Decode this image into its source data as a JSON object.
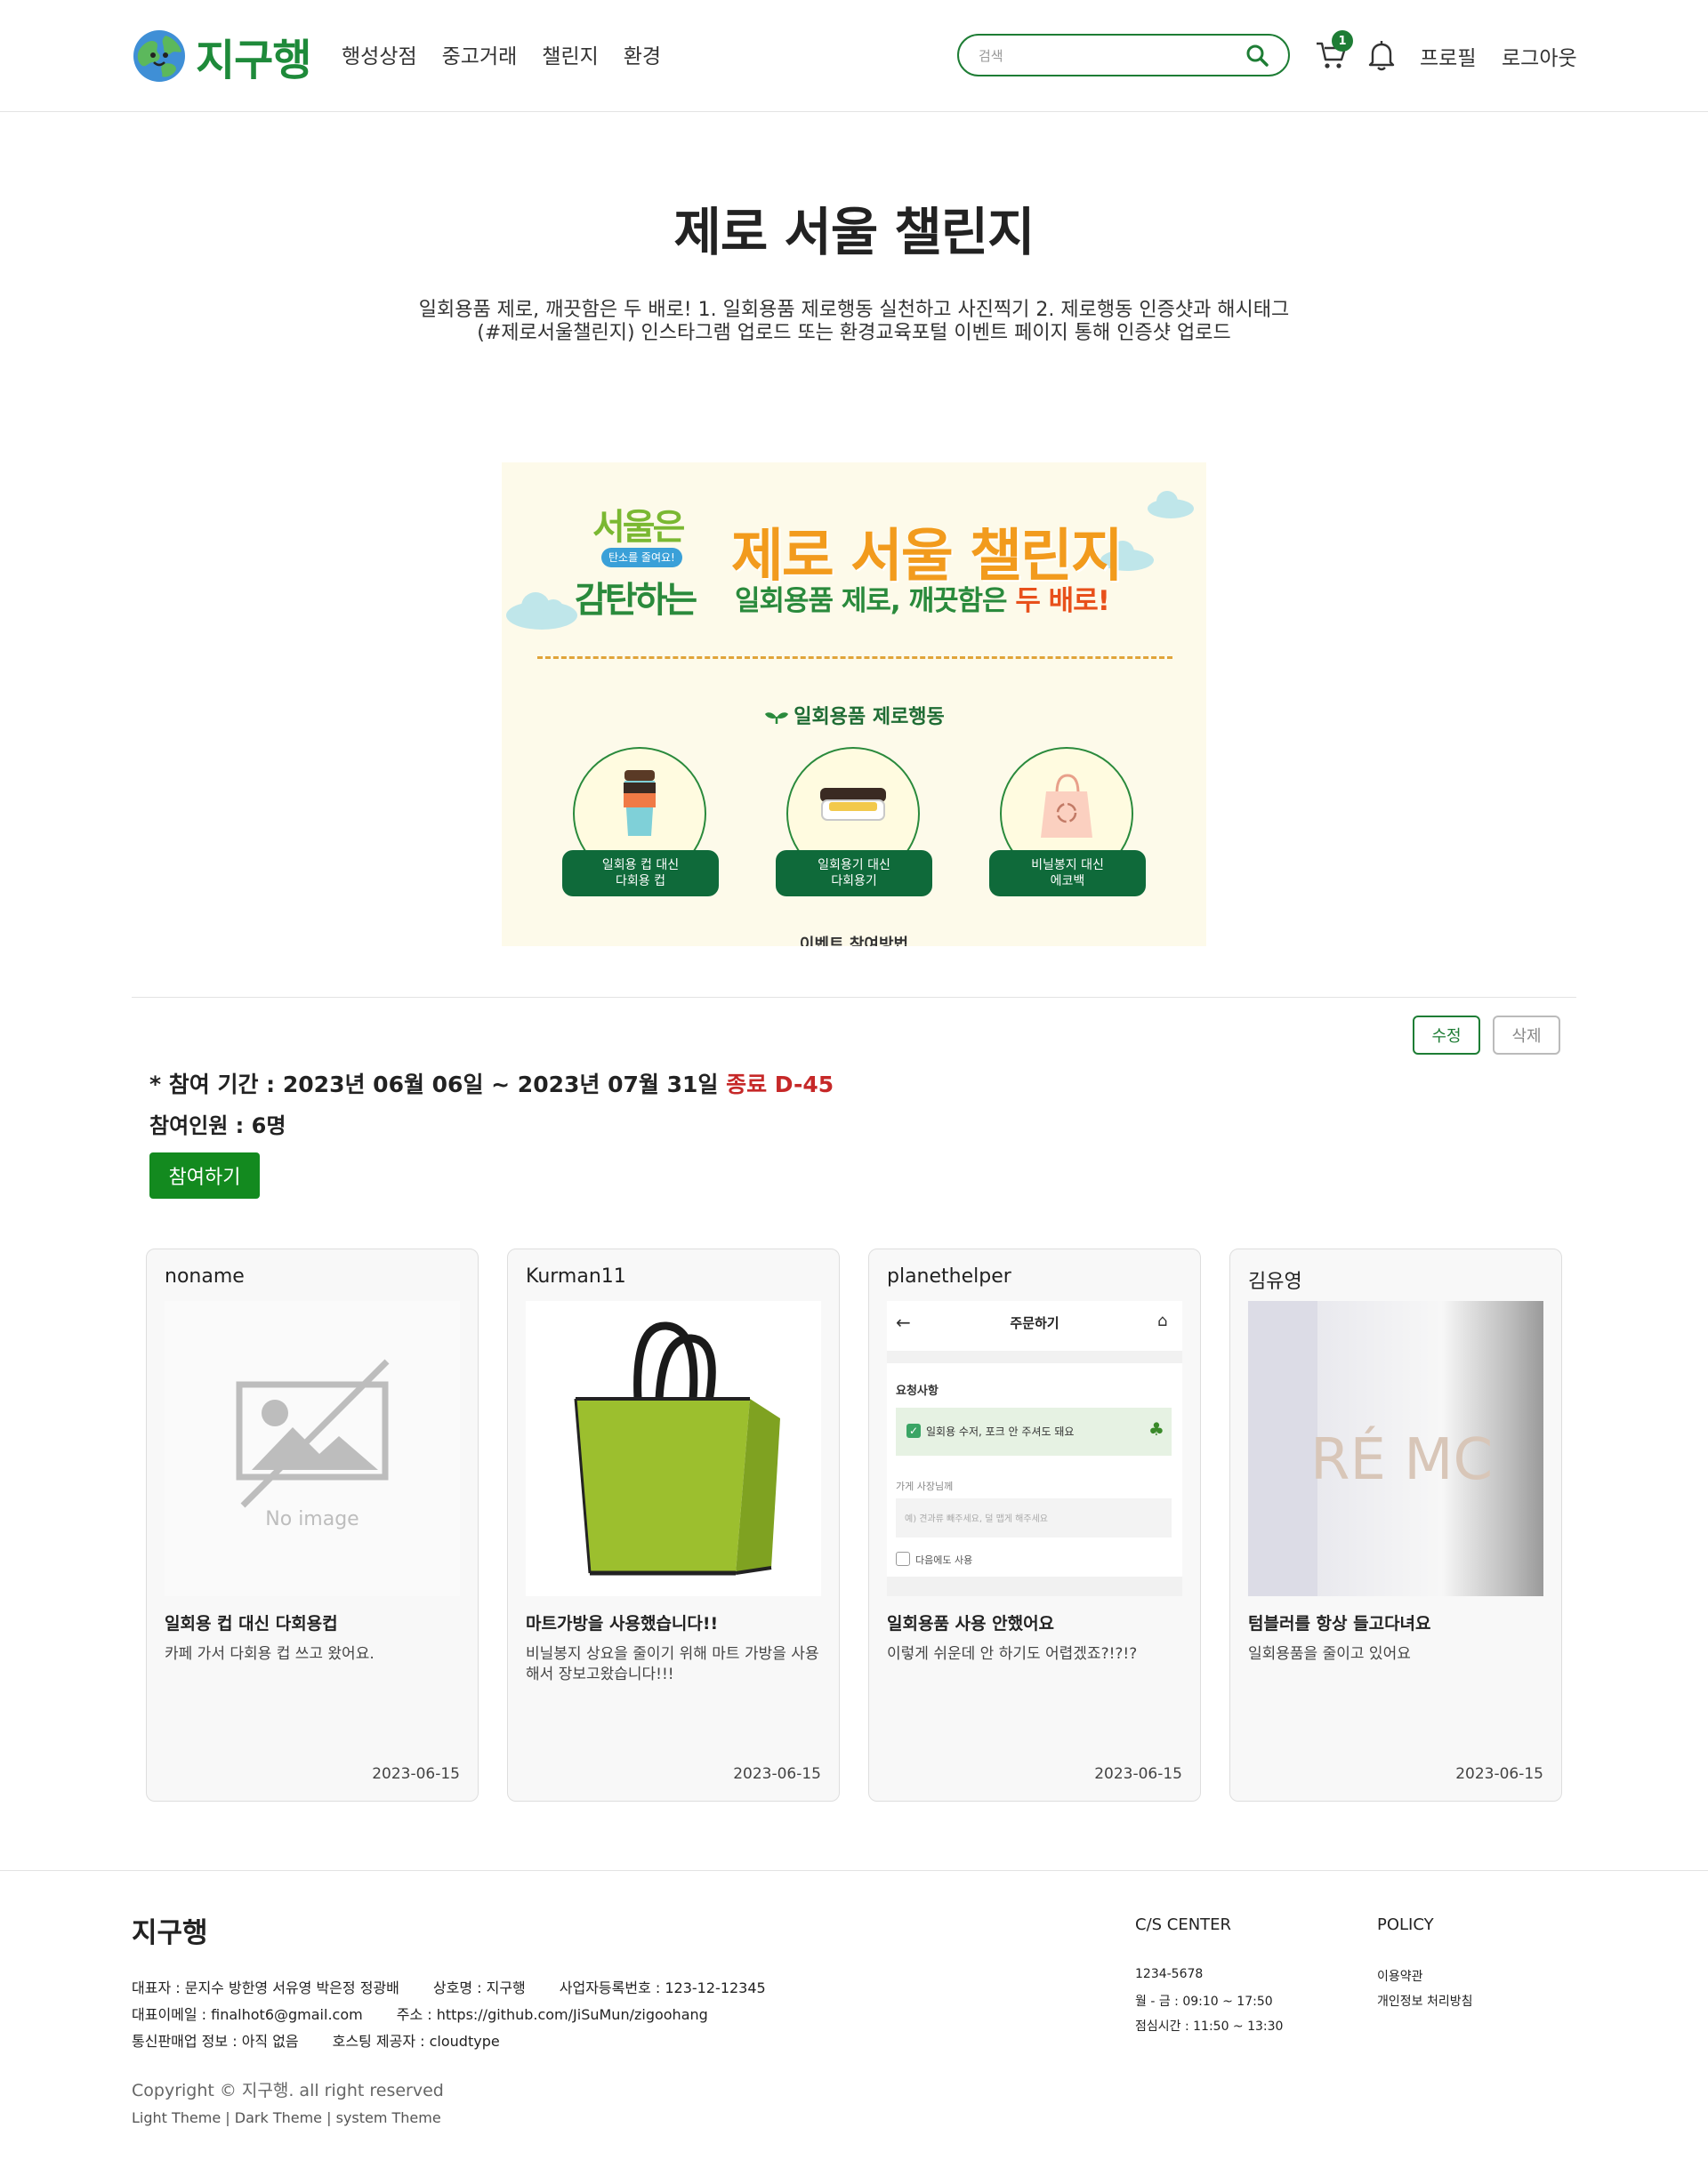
{
  "header": {
    "logo_text": "지구행",
    "nav": [
      "행성상점",
      "중고거래",
      "챌린지",
      "환경"
    ],
    "search_placeholder": "검색",
    "cart_count": "1",
    "profile_label": "프로필",
    "logout_label": "로그아웃"
  },
  "challenge": {
    "title": "제로 서울 챌린지",
    "description": "일회용품 제로, 깨끗함은 두 배로! 1. 일회용품 제로행동 실천하고 사진찍기 2. 제로행동 인증샷과 해시태그 (#제로서울챌린지) 인스타그램 업로드 또는 환경교육포털 이벤트 페이지 통해 인증샷 업로드"
  },
  "banner": {
    "logo_line1": "서울은",
    "logo_ribbon": "탄소를 줄여요!",
    "logo_line2": "감탄하는",
    "title": "제로 서울 챌린지",
    "subtitle_a": "일회용품 ",
    "subtitle_b": "제로, 깨끗함은 ",
    "subtitle_c": "두 배로!",
    "section": "일회용품 제로행동",
    "items": [
      {
        "label": "일회용 컵 대신\n다회용 컵"
      },
      {
        "label": "일회용기 대신\n다회용기"
      },
      {
        "label": "비닐봉지 대신\n에코백"
      }
    ],
    "more": "이벤트 참여방법"
  },
  "actions": {
    "edit_label": "수정",
    "delete_label": "삭제"
  },
  "info": {
    "period_label": "* 참여 기간 : 2023년 06월 06일 ~ 2023년 07월 31일 ",
    "period_status": "종료 D-45",
    "participants": "참여인원 : 6명",
    "join_label": "참여하기"
  },
  "cards": [
    {
      "user": "noname",
      "title": "일회용 컵 대신 다회용컵",
      "body": "카페 가서 다회용 컵 쓰고 왔어요.",
      "date": "2023-06-15",
      "image": "no-image",
      "no_image_text": "No image"
    },
    {
      "user": "Kurman11",
      "title": "마트가방을 사용했습니다!!",
      "body": "비닐봉지 상요을 줄이기 위해 마트 가방을 사용해서 장보고왔습니다!!!",
      "date": "2023-06-15",
      "image": "green-bag"
    },
    {
      "user": "planethelper",
      "title": "일회용품 사용 안했어요",
      "body": "이렇게 쉬운데 안 하기도 어렵겠죠?!?!?",
      "date": "2023-06-15",
      "image": "order-screenshot",
      "shot": {
        "header": "주문하기",
        "request": "요청사항",
        "option": "일회용 수저, 포크 안 주셔도 돼요",
        "owner": "가게 사장님께",
        "placeholder": "예) 견과류 빼주세요, 덜 맵게 해주세요",
        "next": "다음에도 사용"
      }
    },
    {
      "user": "김유영",
      "title": "텀블러를 항상 들고다녀요",
      "body": "일회용품을 줄이고 있어요",
      "date": "2023-06-15",
      "image": "tumbler",
      "tumbler_text": "RÉ  MC"
    }
  ],
  "footer": {
    "brand": "지구행",
    "ceo": "대표자 : 문지수 방한영 서유영 박은정 정광배",
    "company": "상호명 : 지구행",
    "biz_no": "사업자등록번호 : 123-12-12345",
    "email": "대표이메일 : finalhot6@gmail.com",
    "address": "주소 : https://github.com/JiSuMun/zigoohang",
    "telecom": "통신판매업 정보 : 아직 없음",
    "hosting": "호스팅 제공자 : cloudtype",
    "copyright": "Copyright © 지구행. all right reserved",
    "themes": "Light Theme | Dark Theme | system Theme",
    "cs_title": "C/S CENTER",
    "cs_phone": "1234-5678",
    "cs_hours": "월 - 금 : 09:10 ~ 17:50",
    "cs_lunch": "점심시간 : 11:50 ~ 13:30",
    "policy_title": "POLICY",
    "policy_terms": "이용약관",
    "policy_privacy": "개인정보 처리방침"
  },
  "colors": {
    "brand": "#1e7d35",
    "join": "#138a1f",
    "deadline": "#c62828"
  }
}
